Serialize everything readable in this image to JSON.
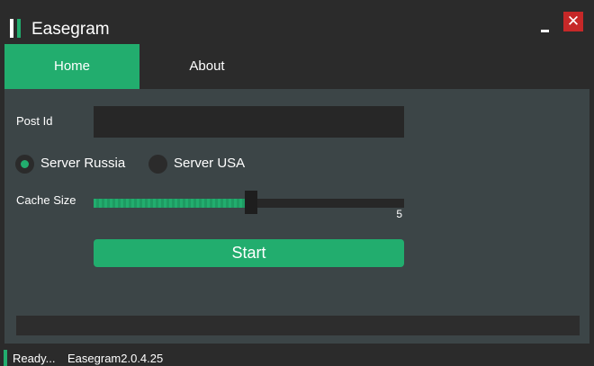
{
  "window": {
    "title": "Easegram",
    "logo_colors": [
      "#ffffff",
      "#22ad6e"
    ],
    "minimize_icon": "minimize-icon",
    "close_symbol": "✕",
    "close_color": "#c62828"
  },
  "tabs": [
    {
      "label": "Home",
      "active": true
    },
    {
      "label": "About",
      "active": false
    }
  ],
  "form": {
    "post_id": {
      "label": "Post Id",
      "value": "",
      "placeholder": ""
    },
    "server": {
      "options": [
        {
          "label": "Server Russia",
          "selected": true
        },
        {
          "label": "Server USA",
          "selected": false
        }
      ]
    },
    "cache_size": {
      "label": "Cache Size",
      "value": "5",
      "min": 0,
      "max": 10,
      "fraction": 0.5
    },
    "start_label": "Start",
    "progress": 0
  },
  "status": {
    "text": "Ready...",
    "version": "Easegram2.0.4.25"
  },
  "colors": {
    "accent": "#22ad6e",
    "background": "#2b2b2b",
    "panel": "#3c4547"
  }
}
